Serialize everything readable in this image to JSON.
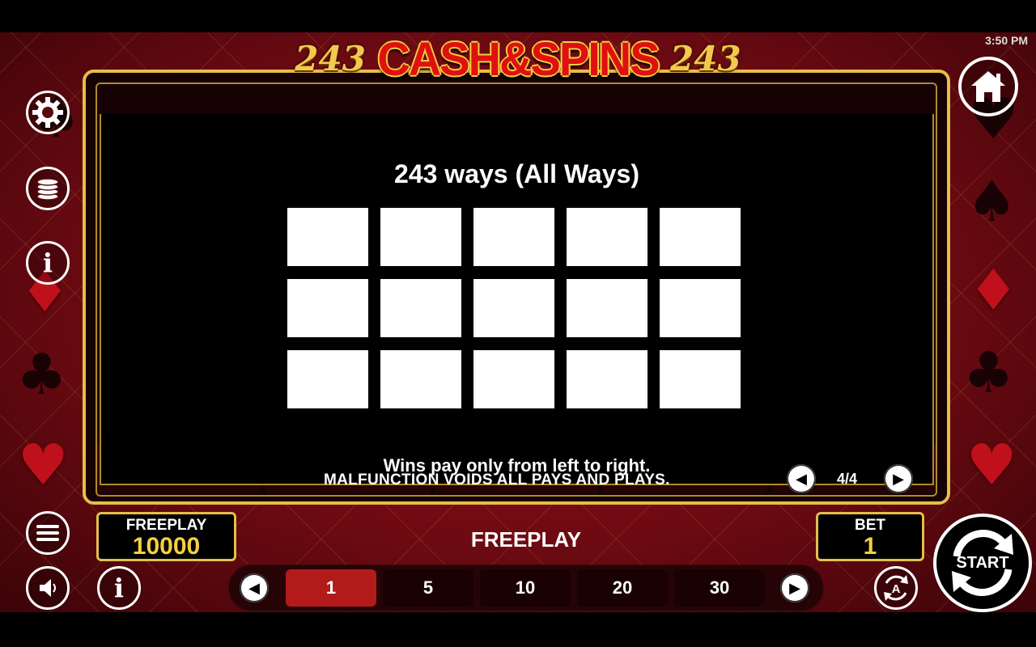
{
  "status": {
    "time": "3:50 PM"
  },
  "logo": {
    "left_number": "243",
    "name": "CASH&SPINS",
    "right_number": "243"
  },
  "paytable": {
    "title": "243 ways (All Ways)",
    "note": "Wins pay only from left to right.",
    "grid": {
      "rows": 3,
      "columns": 5
    }
  },
  "footer": {
    "malfunction": "MALFUNCTION VOIDS ALL PAYS AND PLAYS.",
    "page_indicator": "4/4"
  },
  "balance": {
    "label": "FREEPLAY",
    "value": "10000"
  },
  "mode_label": "FREEPLAY",
  "bet": {
    "label": "BET",
    "value": "1"
  },
  "bet_options": [
    {
      "label": "1",
      "selected": true
    },
    {
      "label": "5",
      "selected": false
    },
    {
      "label": "10",
      "selected": false
    },
    {
      "label": "20",
      "selected": false
    },
    {
      "label": "30",
      "selected": false
    }
  ],
  "start_button": {
    "label": "START"
  },
  "icons": {
    "settings": "gear-icon",
    "coins": "coin-stack-icon",
    "info": "info-icon",
    "menu": "menu-icon",
    "sound": "speaker-icon",
    "info_bottom": "info-icon",
    "home": "home-icon",
    "autoplay": "autoplay-icon",
    "prev": "triangle-left-icon",
    "next": "triangle-right-icon"
  },
  "colors": {
    "gold": "#e6bd4a",
    "background_red": "#8a0e17",
    "active_bet": "#b31b1b",
    "value_yellow": "#f4d03f"
  }
}
